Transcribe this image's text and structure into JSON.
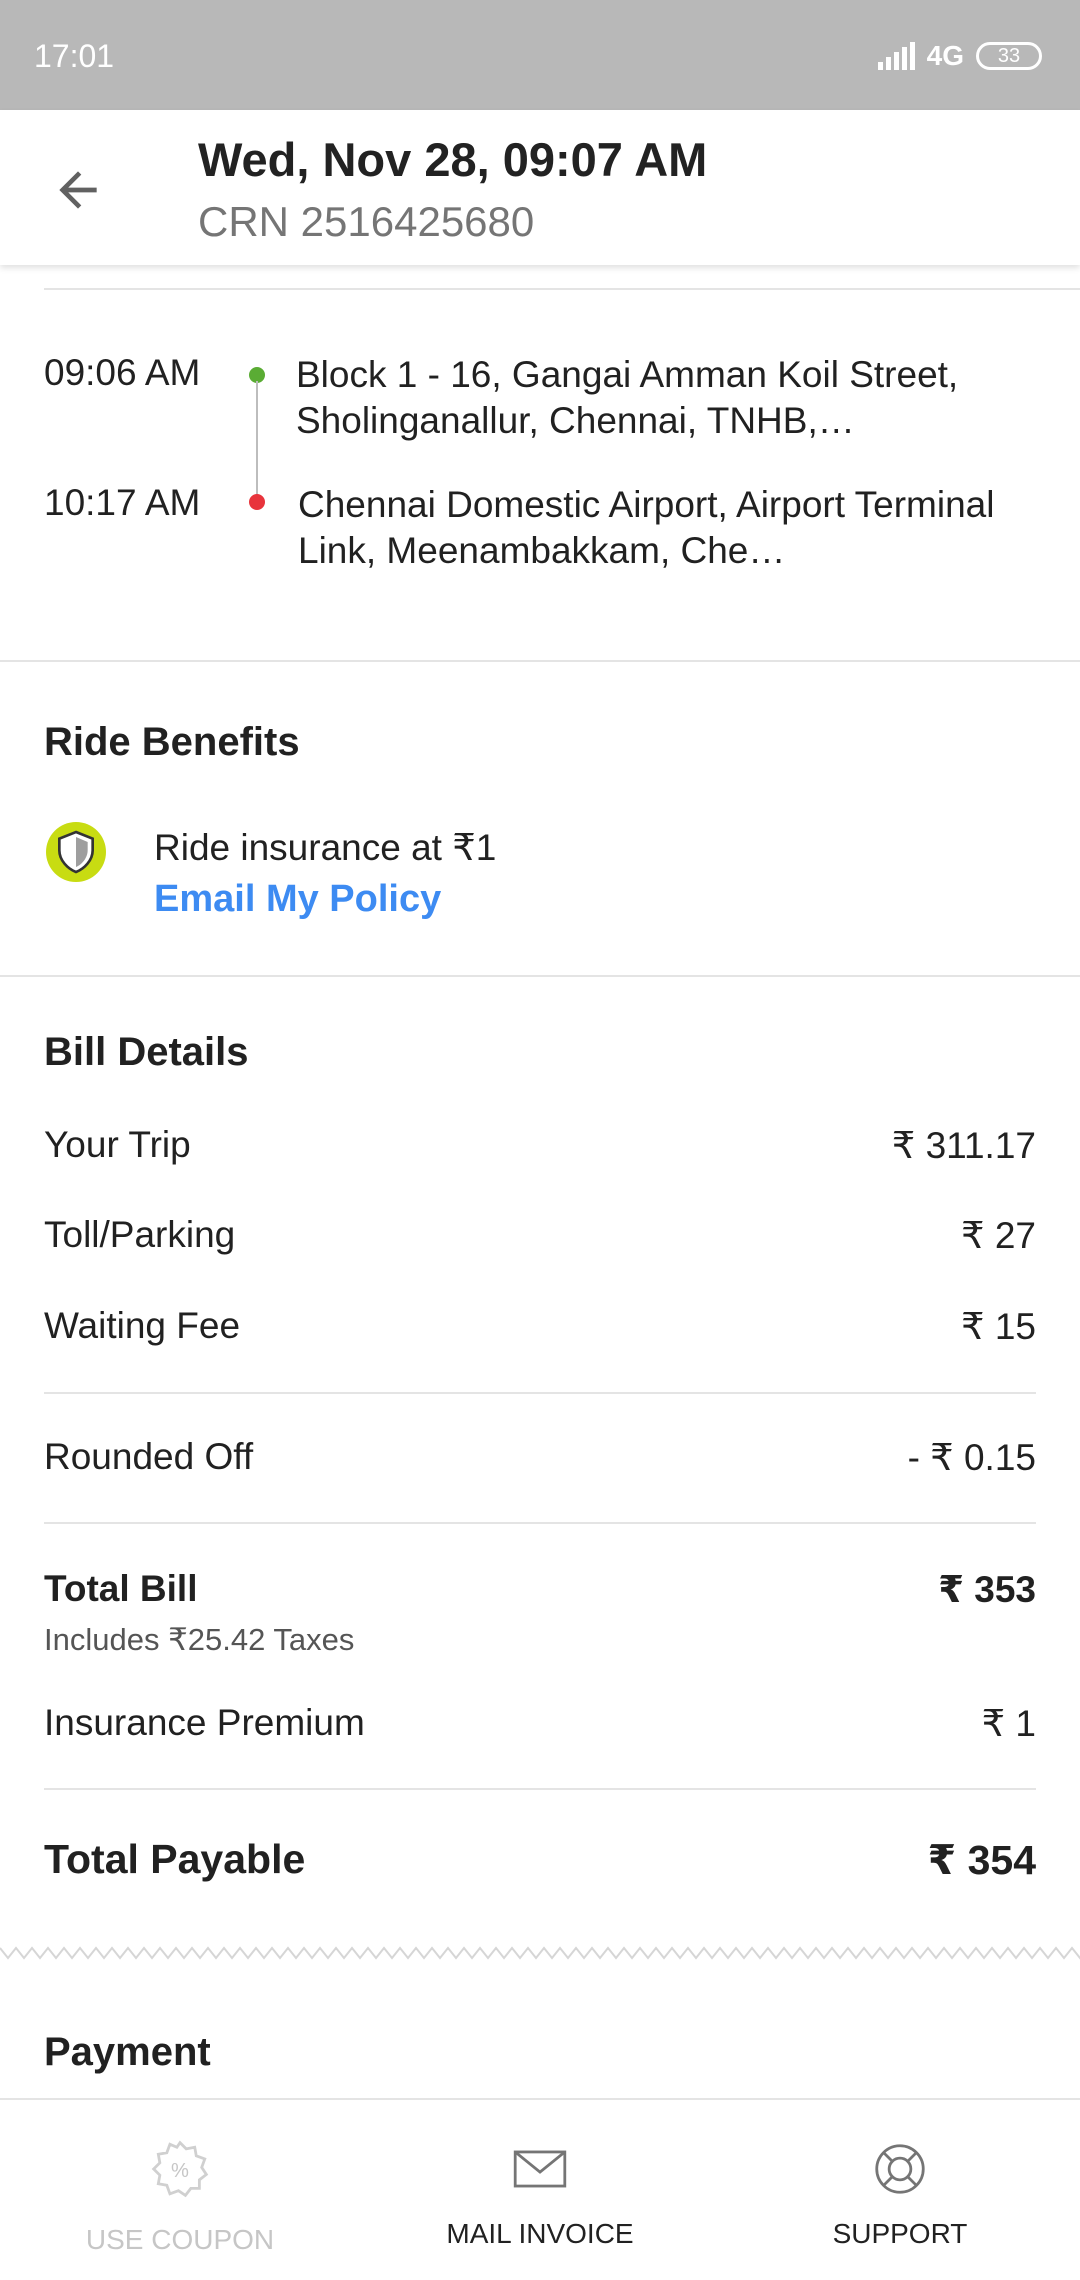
{
  "status_bar": {
    "time": "17:01",
    "network": "4G",
    "network_sub": "ıt",
    "battery": "33"
  },
  "header": {
    "title": "Wed, Nov 28, 09:07 AM",
    "subtitle": "CRN 2516425680"
  },
  "route": {
    "pickup": {
      "time": "09:06 AM",
      "address": "Block 1 - 16, Gangai Amman Koil Street, Sholinganallur, Chennai, TNHB,…",
      "color": "#5aac34"
    },
    "drop": {
      "time": "10:17 AM",
      "address": "Chennai Domestic Airport, Airport Terminal Link, Meenambakkam, Che…",
      "color": "#e8343c"
    }
  },
  "ride_benefits": {
    "title": "Ride Benefits",
    "insurance_text": "Ride insurance at ₹1",
    "email_link": "Email My Policy",
    "link_color": "#3d8bf2",
    "badge_color": "#c8dc12"
  },
  "bill": {
    "title": "Bill Details",
    "items": [
      {
        "label": "Your Trip",
        "value": "₹ 311.17"
      },
      {
        "label": "Toll/Parking",
        "value": "₹ 27"
      },
      {
        "label": "Waiting Fee",
        "value": "₹ 15"
      }
    ],
    "rounded_off": {
      "label": "Rounded Off",
      "value": "- ₹ 0.15"
    },
    "total_bill": {
      "label": "Total Bill",
      "value": "₹ 353",
      "note": "Includes ₹25.42 Taxes"
    },
    "insurance": {
      "label": "Insurance Premium",
      "value": "₹ 1"
    },
    "total_payable": {
      "label": "Total Payable",
      "value": "₹ 354"
    }
  },
  "payment": {
    "title": "Payment"
  },
  "bottom_nav": {
    "coupon": {
      "label": "USE COUPON",
      "icon": "coupon-icon",
      "disabled": true
    },
    "mail": {
      "label": "MAIL INVOICE",
      "icon": "mail-icon"
    },
    "support": {
      "label": "SUPPORT",
      "icon": "support-icon"
    }
  }
}
